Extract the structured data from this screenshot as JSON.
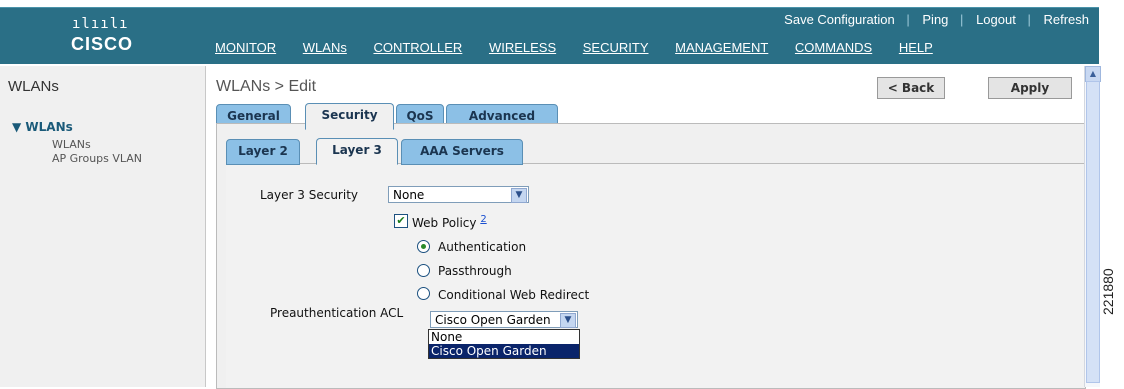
{
  "header": {
    "logo_bars": "ılıılı",
    "logo_word": "CISCO",
    "top_links": [
      "Save Configuration",
      "Ping",
      "Logout",
      "Refresh"
    ],
    "nav_items": [
      "MONITOR",
      "WLANs",
      "CONTROLLER",
      "WIRELESS",
      "SECURITY",
      "MANAGEMENT",
      "COMMANDS",
      "HELP"
    ]
  },
  "sidebar": {
    "title": "WLANs",
    "group_label": "WLANs",
    "items": [
      "WLANs",
      "AP Groups VLAN"
    ]
  },
  "main": {
    "page_title": "WLANs > Edit",
    "back_label": "< Back",
    "apply_label": "Apply",
    "tabs": [
      "General",
      "Security",
      "QoS",
      "Advanced"
    ],
    "subtabs": [
      "Layer 2",
      "Layer 3",
      "AAA Servers"
    ],
    "layer3_security_label": "Layer 3 Security",
    "layer3_security_value": "None",
    "web_policy_label": "Web Policy",
    "web_policy_note": "2",
    "radio_options": [
      "Authentication",
      "Passthrough",
      "Conditional Web Redirect"
    ],
    "preauth_label": "Preauthentication ACL",
    "preauth_value": "Cisco Open Garden",
    "dropdown_options": [
      "None",
      "Cisco Open Garden"
    ]
  },
  "figure_number": "221880",
  "colors": {
    "header": "#2a6f86",
    "tab": "#8cc0e6",
    "highlight": "#0a246a"
  }
}
